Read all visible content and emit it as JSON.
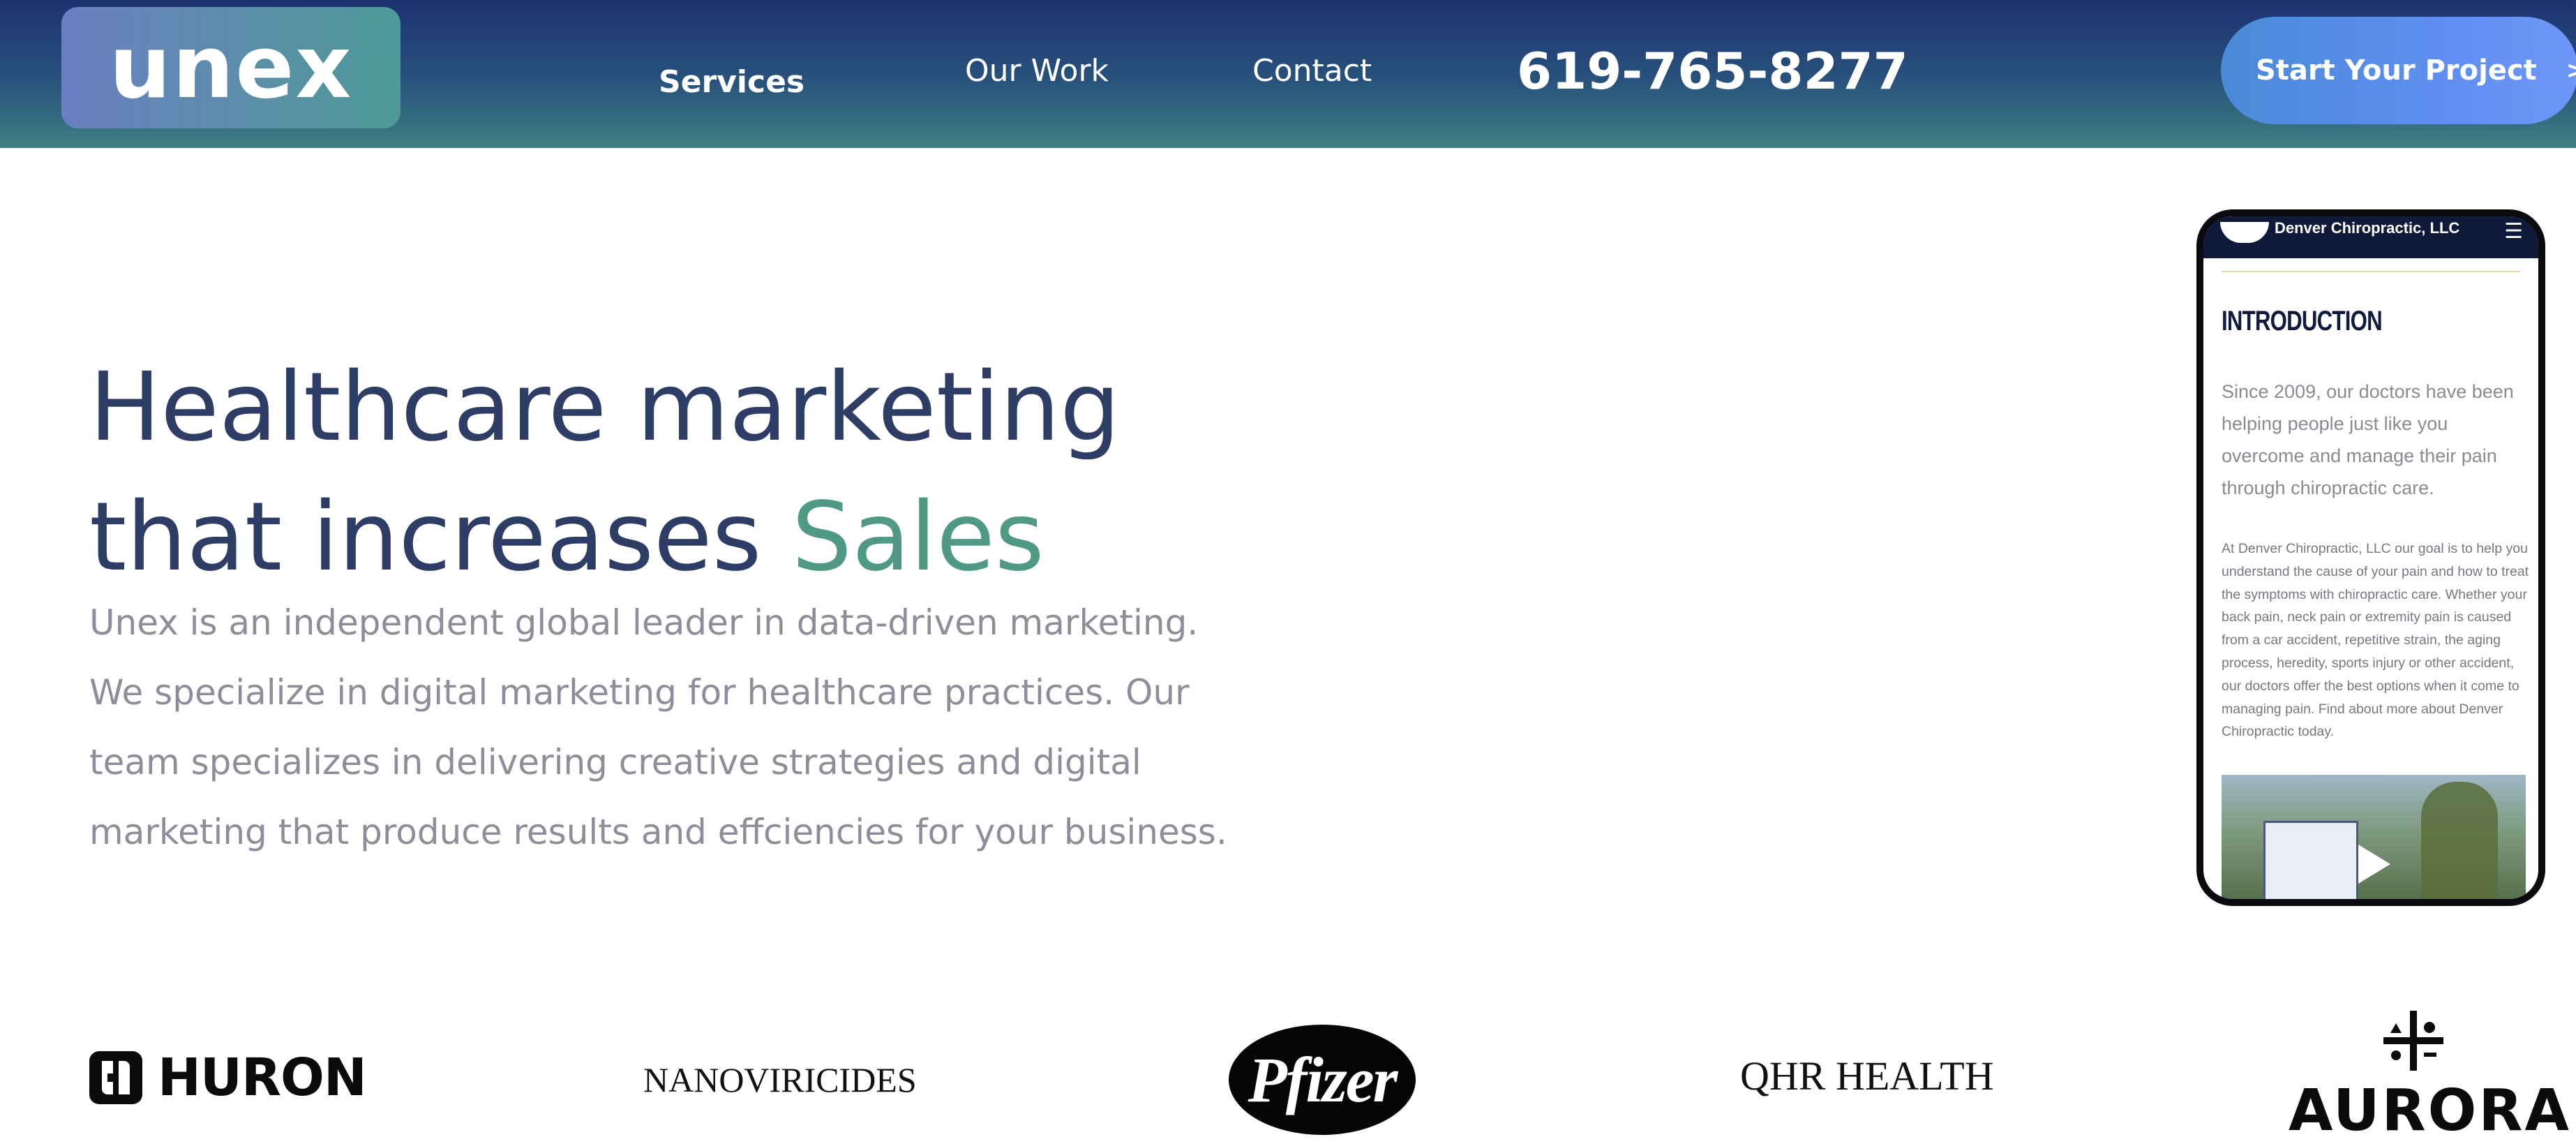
{
  "header": {
    "logo_text": "unex",
    "nav": [
      {
        "label": "Services"
      },
      {
        "label": "Our Work"
      },
      {
        "label": "Contact"
      }
    ],
    "phone": "619-765-8277",
    "cta_label": "Start Your Project",
    "cta_icon": "chevron-right-icon",
    "colors": {
      "header_start": "#1d3272",
      "header_end": "#3f7f83",
      "cta": "#5e8ef0"
    }
  },
  "hero": {
    "title_line1": "Healthcare marketing",
    "title_line2_prefix": "that increases ",
    "title_accent": "Sales",
    "accent_color": "#4f9985",
    "title_color": "#2e3d66",
    "body_lines": [
      "Unex is an independent global leader in data-driven marketing.",
      "We specialize in digital marketing for healthcare practices. Our",
      "team specializes in delivering creative strategies and digital",
      "marketing that produce results and effciencies for your business."
    ]
  },
  "device_preview": {
    "brand": "Denver Chiropractic, LLC",
    "menu_icon": "hamburger-menu-icon",
    "heading": "INTRODUCTION",
    "lead_lines": [
      "Since 2009, our doctors have been",
      "helping people just like you",
      "overcome and manage their pain",
      "through chiropractic care."
    ],
    "body_lines": [
      "At Denver Chiropractic, LLC our goal is to help you",
      "understand the cause of your pain and how to treat",
      "the symptoms with chiropractic care. Whether your",
      "back pain, neck pain or extremity pain is caused",
      "from a car accident, repetitive strain, the aging",
      "process, heredity, sports injury or other accident,",
      "our doctors offer the best options when it come to",
      "managing pain. Find about more about Denver",
      "Chiropractic today."
    ],
    "video_icon": "play-icon"
  },
  "clients": {
    "huron": "HURON",
    "nanoviricides": "NANOVIRICIDES",
    "pfizer": "Pfizer",
    "qhr": "QHR HEALTH",
    "aurora": "AURORA"
  }
}
